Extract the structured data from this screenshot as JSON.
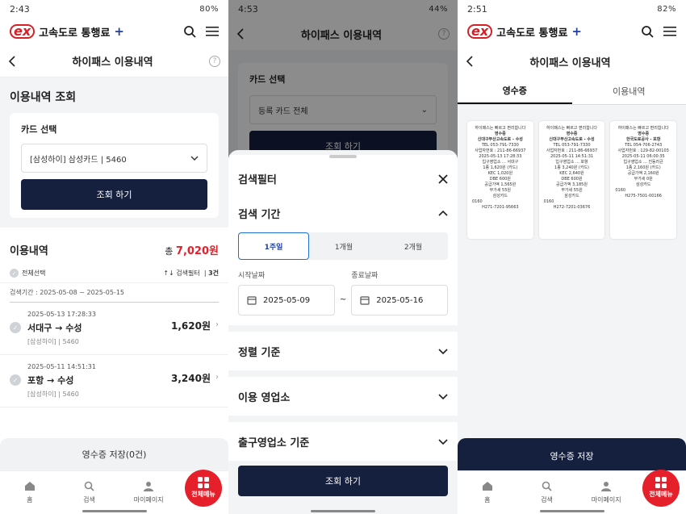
{
  "screen1": {
    "status": {
      "time": "2:43",
      "right": "80%"
    },
    "brand": {
      "logo": "ex",
      "name": "고속도로 통행료",
      "plus": "+"
    },
    "title": "하이패스 이용내역",
    "help": "?",
    "query": {
      "section_title": "이용내역 조회",
      "card_label": "카드 선택",
      "card_value": "[삼성하이] 삼성카드 | 5460",
      "search_button": "조회 하기"
    },
    "history": {
      "title": "이용내역",
      "total_prefix": "총",
      "total_amount": "7,020원",
      "select_all": "전체선택",
      "filter": "검색필터",
      "count": "3건",
      "period": "검색기간 : 2025-05-08 ~ 2025-05-15",
      "items": [
        {
          "datetime": "2025-05-13 17:28:33",
          "route": "서대구 → 수성",
          "fare": "1,620원",
          "card": "[삼성하이]  |  5460"
        },
        {
          "datetime": "2025-05-11 14:51:31",
          "route": "포항 → 수성",
          "fare": "3,240원",
          "card": "[삼성하이]  |  5460"
        }
      ]
    },
    "save_button": "영수증 저장(0건)"
  },
  "screen2": {
    "status": {
      "time": "4:53",
      "right": "44%"
    },
    "title": "하이패스 이용내역",
    "bg_card_label": "카드 선택",
    "bg_card_value": "등록 카드 전체",
    "bg_search": "조회 하기",
    "sheet": {
      "title": "검색필터",
      "period_title": "검색 기간",
      "periods": [
        "1주일",
        "1개월",
        "2개월"
      ],
      "start_label": "시작날짜",
      "start_date": "2025-05-09",
      "end_label": "종료날짜",
      "end_date": "2025-05-16",
      "tilde": "~",
      "sort_title": "정렬 기준",
      "office_title": "이용 영업소",
      "exit_title": "출구영업소 기준",
      "search_button": "조회 하기"
    }
  },
  "screen3": {
    "status": {
      "time": "2:51",
      "right": "82%"
    },
    "title": "하이패스 이용내역",
    "tabs": [
      "영수증",
      "이용내역"
    ],
    "receipts": [
      {
        "head": "하이패스는 빠르고 편리합니다",
        "kind": "영수증",
        "company": "신대구부산고속도로 - 수성",
        "tel": "TEL    053-791-7330",
        "biz": "사업자번호 : 211-86-66937",
        "dt": "2025-05-13 17:28:33",
        "entry": "입구영업소  ...  서대구",
        "class": "1종     1,620원 (카드)",
        "kec": "KEC        1,020원",
        "dbe": "DBE         600원",
        "supply": "공급가액          1,565원",
        "vat": "부가세                55원",
        "card": "삼성카드",
        "num": "0160",
        "code": "H271-7201-95663"
      },
      {
        "head": "하이패스는 빠르고 편리합니다",
        "kind": "영수증",
        "company": "신대구부산고속도로 - 수성",
        "tel": "TEL    053-791-7330",
        "biz": "사업자번호 : 211-86-66937",
        "dt": "2025-05-11 14:51:31",
        "entry": "입구영업소  ...  포항",
        "class": "1종     3,240원 (카드)",
        "kec": "KEC        2,640원",
        "dbe": "DBE         600원",
        "supply": "공급가액          3,185원",
        "vat": "부가세                55원",
        "card": "삼성카드",
        "num": "0160",
        "code": "H272-7201-03676"
      },
      {
        "head": "하이패스는 빠르고 편리합니다",
        "kind": "영수증",
        "company": "한국도로공사 - 포항",
        "tel": "TEL    054-706-2743",
        "biz": "사업자번호 : 129-82-00103",
        "dt": "2025-05-11 06:00:35",
        "entry": "입구영업소  ...  진동러큰",
        "class": "1종     2,160원 (카드)",
        "kec": "",
        "dbe": "",
        "supply": "공급가액          2,160원",
        "vat": "부가세                 0원",
        "card": "삼성카드",
        "num": "0160",
        "code": "H275-7501-00166"
      }
    ],
    "save_button": "영수증 저장"
  },
  "nav": {
    "home": "홈",
    "search": "검색",
    "mypage": "마이페이지",
    "menu": "전체메뉴"
  }
}
